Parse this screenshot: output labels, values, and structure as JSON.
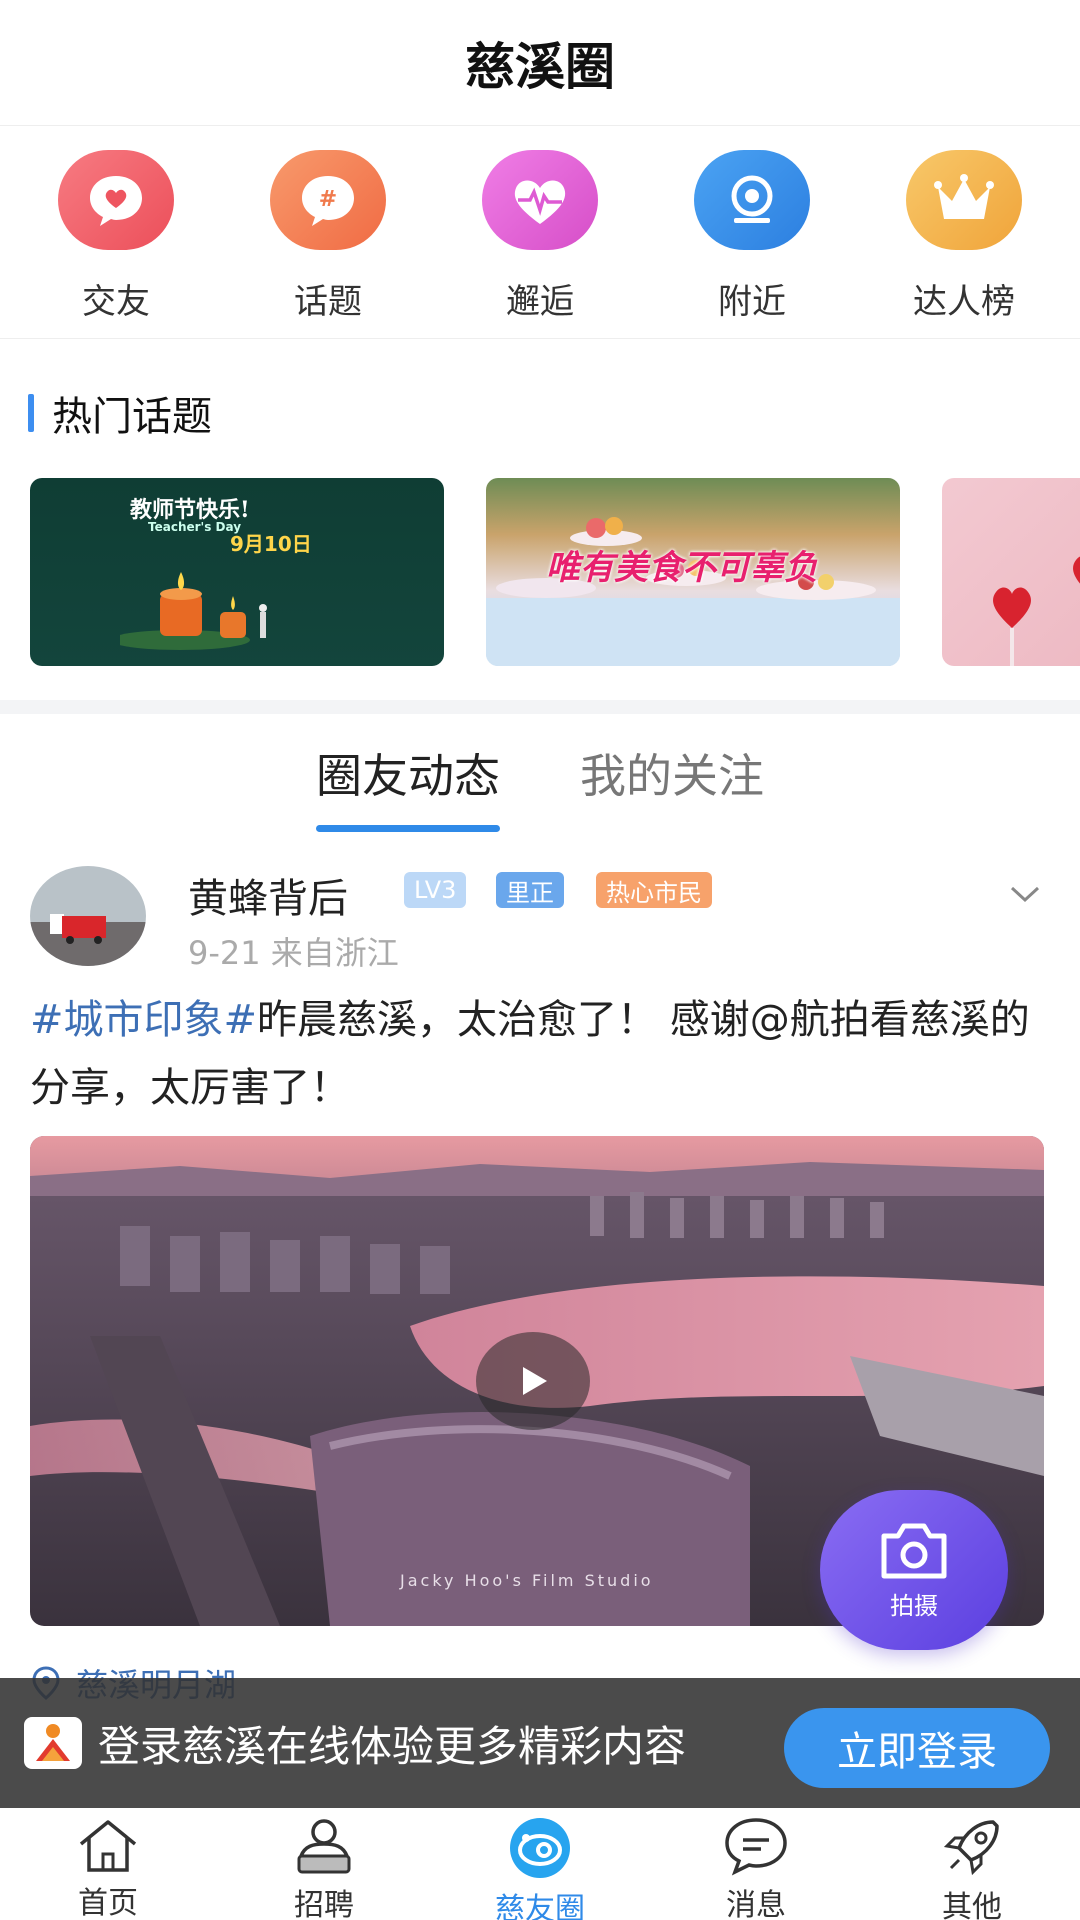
{
  "header": {
    "title": "慈溪圈"
  },
  "shortcuts": [
    {
      "label": "交友",
      "icon": "heart-chat-icon",
      "color": "#f0616a"
    },
    {
      "label": "话题",
      "icon": "hashtag-chat-icon",
      "color": "#f5875a"
    },
    {
      "label": "邂逅",
      "icon": "heartbeat-icon",
      "color": "#e35fd3"
    },
    {
      "label": "附近",
      "icon": "location-icon",
      "color": "#3c8ee8"
    },
    {
      "label": "达人榜",
      "icon": "crown-icon",
      "color": "#f4b64c"
    }
  ],
  "hot_topics": {
    "title": "热门话题",
    "cards": [
      {
        "caption": "教师节快乐!",
        "sub": "Teacher's Day",
        "date": "9月10日"
      },
      {
        "caption": "唯有美食不可辜负"
      },
      {
        "caption": ""
      }
    ]
  },
  "tabs": [
    {
      "label": "圈友动态",
      "active": true
    },
    {
      "label": "我的关注",
      "active": false
    }
  ],
  "post": {
    "author": "黄蜂背后",
    "badges": [
      {
        "text": "LV3",
        "color": "#a9cdf5"
      },
      {
        "text": "里正",
        "color": "#6aa7ec"
      },
      {
        "text": "热心市民",
        "color": "#f7a26b"
      }
    ],
    "meta": "9-21 来自浙江",
    "hashtag": "#城市印象#",
    "text": "昨晨慈溪，太治愈了！ 感谢@航拍看慈溪的分享，太厉害了！",
    "watermark": "Jacky Hoo's Film Studio",
    "location": "慈溪明月湖"
  },
  "fab": {
    "label": "拍摄"
  },
  "login_banner": {
    "text": "登录慈溪在线体验更多精彩内容",
    "button": "立即登录"
  },
  "bottom_nav": [
    {
      "label": "首页",
      "icon": "home-icon",
      "active": false
    },
    {
      "label": "招聘",
      "icon": "recruit-icon",
      "active": false
    },
    {
      "label": "慈友圈",
      "icon": "circle-icon",
      "active": true
    },
    {
      "label": "消息",
      "icon": "message-icon",
      "active": false
    },
    {
      "label": "其他",
      "icon": "rocket-icon",
      "active": false
    }
  ]
}
